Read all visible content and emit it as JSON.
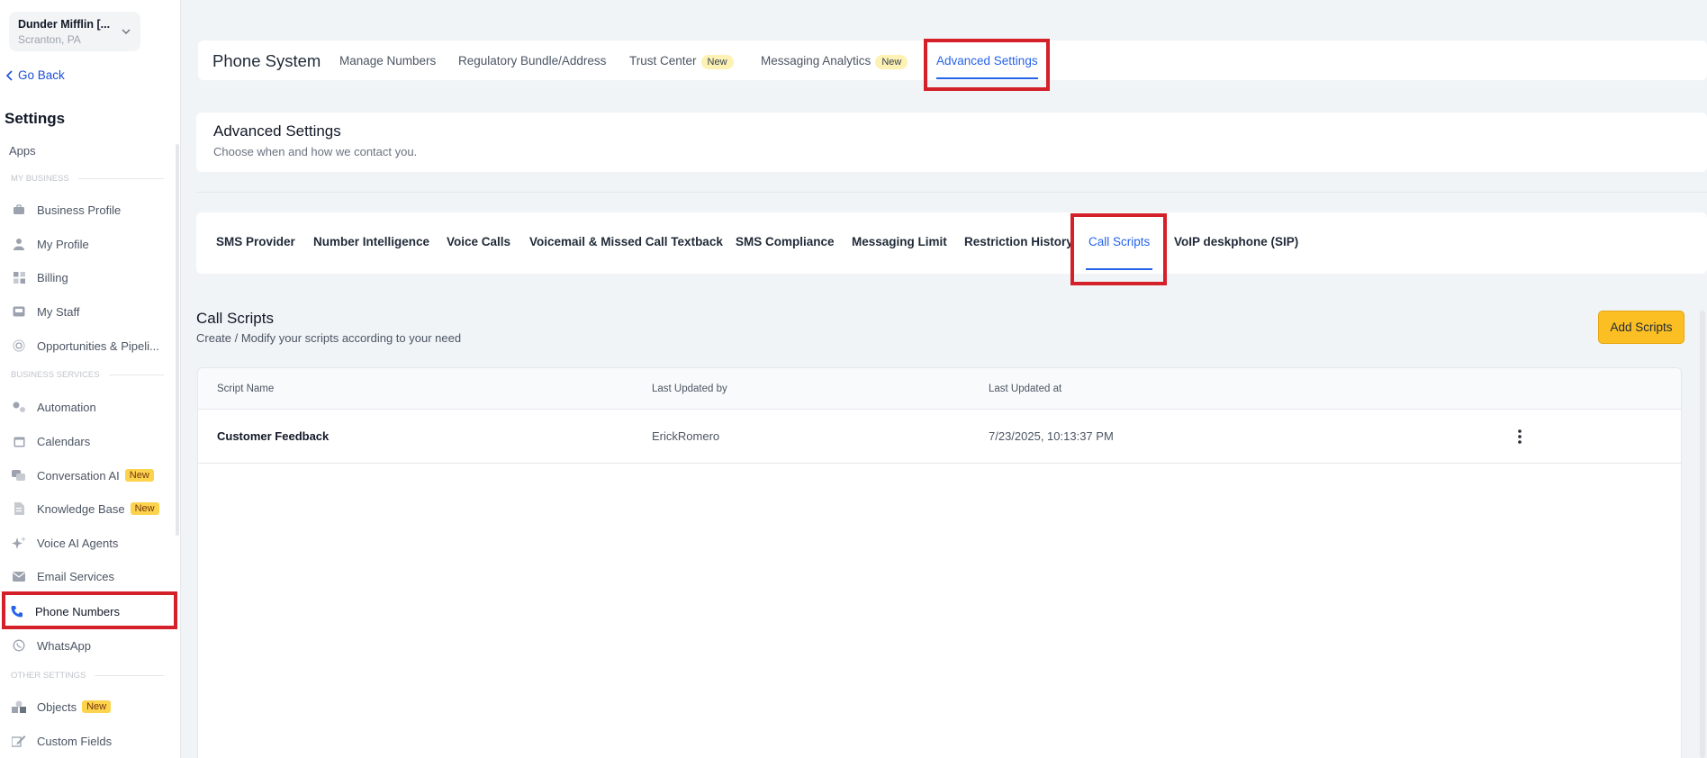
{
  "account": {
    "name": "Dunder Mifflin [...",
    "location": "Scranton, PA"
  },
  "sidebar": {
    "go_back": "Go Back",
    "title": "Settings",
    "apps": "Apps",
    "sections": {
      "my_business": "MY BUSINESS",
      "business_services": "BUSINESS SERVICES",
      "other_settings": "OTHER SETTINGS"
    },
    "items": [
      {
        "label": "Business Profile",
        "icon": "briefcase-icon"
      },
      {
        "label": "My Profile",
        "icon": "person-icon"
      },
      {
        "label": "Billing",
        "icon": "grid-icon"
      },
      {
        "label": "My Staff",
        "icon": "inbox-icon"
      },
      {
        "label": "Opportunities & Pipeli...",
        "icon": "target-icon"
      },
      {
        "label": "Automation",
        "icon": "gears-icon"
      },
      {
        "label": "Calendars",
        "icon": "calendar-icon"
      },
      {
        "label": "Conversation AI",
        "icon": "chat-icon",
        "badge": "New"
      },
      {
        "label": "Knowledge Base",
        "icon": "document-icon",
        "badge": "New"
      },
      {
        "label": "Voice AI Agents",
        "icon": "sparkle-icon"
      },
      {
        "label": "Email Services",
        "icon": "mail-icon"
      },
      {
        "label": "Phone Numbers",
        "icon": "phone-icon",
        "active": true
      },
      {
        "label": "WhatsApp",
        "icon": "whatsapp-icon"
      },
      {
        "label": "Objects",
        "icon": "shapes-icon",
        "badge": "New"
      },
      {
        "label": "Custom Fields",
        "icon": "edit-icon"
      }
    ]
  },
  "topbar": {
    "title": "Phone System",
    "tabs": [
      {
        "label": "Manage Numbers"
      },
      {
        "label": "Regulatory Bundle/Address"
      },
      {
        "label": "Trust Center",
        "badge": "New"
      },
      {
        "label": "Messaging Analytics",
        "badge": "New"
      },
      {
        "label": "Advanced Settings",
        "active": true
      }
    ]
  },
  "header": {
    "title": "Advanced Settings",
    "subtitle": "Choose when and how we contact you."
  },
  "subtabs": [
    {
      "label": "SMS Provider"
    },
    {
      "label": "Number Intelligence"
    },
    {
      "label": "Voice Calls"
    },
    {
      "label": "Voicemail & Missed Call Textback"
    },
    {
      "label": "SMS Compliance"
    },
    {
      "label": "Messaging Limit"
    },
    {
      "label": "Restriction History"
    },
    {
      "label": "Call Scripts",
      "active": true
    },
    {
      "label": "VoIP deskphone (SIP)"
    }
  ],
  "call_scripts": {
    "title": "Call Scripts",
    "subtitle": "Create / Modify your scripts according to your need",
    "add_button": "Add Scripts",
    "columns": [
      "Script Name",
      "Last Updated by",
      "Last Updated at"
    ],
    "rows": [
      {
        "name": "Customer Feedback",
        "updated_by": "ErickRomero",
        "updated_at": "7/23/2025, 10:13:37 PM"
      }
    ]
  },
  "colors": {
    "accent": "#2563eb",
    "badge": "#fcd34d",
    "button": "#fbbf24",
    "highlight": "#d32029"
  }
}
